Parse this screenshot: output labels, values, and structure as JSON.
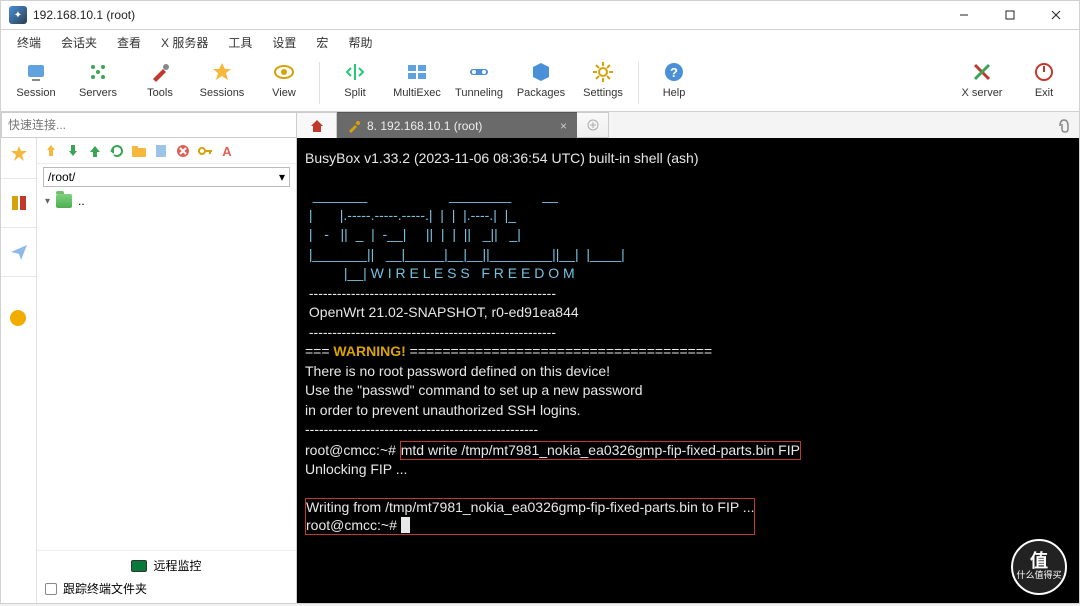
{
  "titlebar": {
    "title": "192.168.10.1 (root)"
  },
  "menu": {
    "terminal": "终端",
    "sessions": "会话夹",
    "view": "查看",
    "xserver": "X 服务器",
    "tools": "工具",
    "settings": "设置",
    "macro": "宏",
    "help": "帮助"
  },
  "toolbar": {
    "session": "Session",
    "servers": "Servers",
    "tools": "Tools",
    "sessions": "Sessions",
    "view": "View",
    "split": "Split",
    "multiexec": "MultiExec",
    "tunneling": "Tunneling",
    "packages": "Packages",
    "settings": "Settings",
    "help": "Help",
    "xserver": "X server",
    "exit": "Exit"
  },
  "quick_connect": {
    "placeholder": "快速连接..."
  },
  "tabs": {
    "active": "8. 192.168.10.1 (root)"
  },
  "sidebar": {
    "path": "/root/",
    "tree_up": "..",
    "remote_monitor": "远程监控",
    "follow_terminal": "跟踪终端文件夹"
  },
  "terminal": {
    "busybox": "BusyBox v1.33.2 (2023-11-06 08:36:54 UTC) built-in shell (ash)",
    "logo1": "  _______                     ________        __",
    "logo2": " |       |.-----.-----.-----.|  |  |  |.----.|  |_",
    "logo3": " |   -   ||  _  |  -__|     ||  |  |  ||   _||   _|",
    "logo4": " |_______||   __|_____|__|__||________||__|  |____|",
    "logo5": "          |__| W I R E L E S S   F R E E D O M",
    "divider": " -----------------------------------------------------",
    "version": " OpenWrt 21.02-SNAPSHOT, r0-ed91ea844",
    "warn_prefix": "=== ",
    "warn_word": "WARNING!",
    "warn_suffix": " =====================================",
    "w1": "There is no root password defined on this device!",
    "w2": "Use the \"passwd\" command to set up a new password",
    "w3": "in order to prevent unauthorized SSH logins.",
    "divider2": "--------------------------------------------------",
    "prompt1_user": "root@cmcc:~# ",
    "cmd1": "mtd write /tmp/mt7981_nokia_ea0326gmp-fip-fixed-parts.bin FIP",
    "unlock": "Unlocking FIP ...",
    "writing": "Writing from /tmp/mt7981_nokia_ea0326gmp-fip-fixed-parts.bin to FIP ...",
    "prompt2_user": "root@cmcc:~# "
  },
  "watermark": {
    "char": "值",
    "text": "什么值得买"
  }
}
